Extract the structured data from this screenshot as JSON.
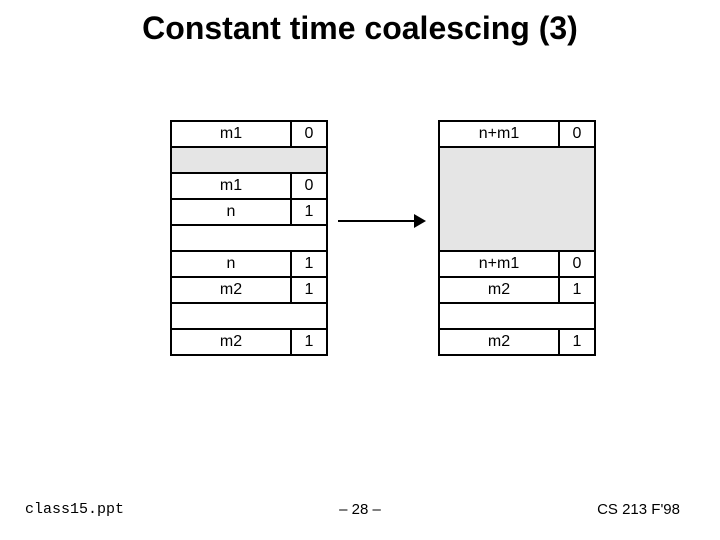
{
  "title": "Constant time coalescing (3)",
  "left_rows": [
    {
      "main": "m1",
      "bit": "0",
      "shade": false
    },
    {
      "gap": true,
      "shade": true
    },
    {
      "main": "m1",
      "bit": "0",
      "shade": false
    },
    {
      "main": "n",
      "bit": "1",
      "shade": false
    },
    {
      "gap": true,
      "shade": false
    },
    {
      "main": "n",
      "bit": "1",
      "shade": false
    },
    {
      "main": "m2",
      "bit": "1",
      "shade": false
    },
    {
      "gap": true,
      "shade": false
    },
    {
      "main": "m2",
      "bit": "1",
      "shade": false
    }
  ],
  "right_rows": [
    {
      "main": "n+m1",
      "bit": "0",
      "shade": false
    },
    {
      "gap": true,
      "shade": true
    },
    {
      "blank": true,
      "shade": true
    },
    {
      "blank": true,
      "shade": true
    },
    {
      "gap": true,
      "shade": true
    },
    {
      "main": "n+m1",
      "bit": "0",
      "shade": false
    },
    {
      "main": "m2",
      "bit": "1",
      "shade": false
    },
    {
      "gap": true,
      "shade": false
    },
    {
      "main": "m2",
      "bit": "1",
      "shade": false
    }
  ],
  "footer": {
    "file": "class15.ppt",
    "page": "– 28 –",
    "course": "CS 213 F'98"
  }
}
